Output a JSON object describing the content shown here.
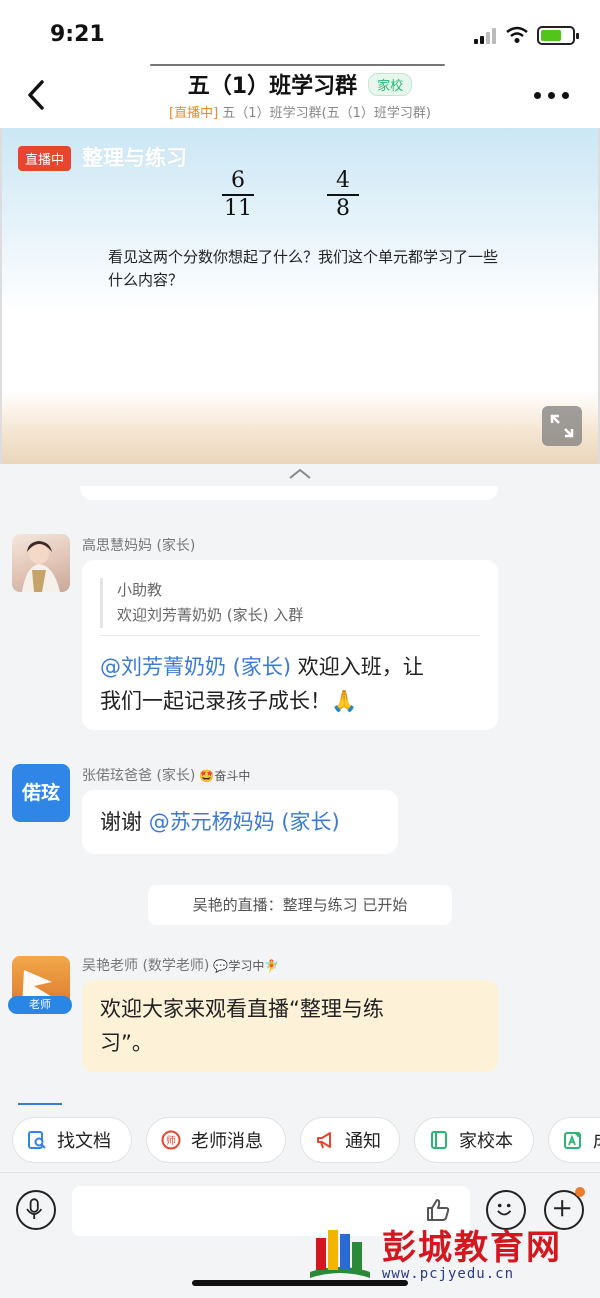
{
  "status_bar": {
    "time": "9:21"
  },
  "header": {
    "title": "五（1）班学习群",
    "tag": "家校",
    "subtitle_live": "[直播中]",
    "subtitle_text": "五（1）班学习群(五（1）班学习群)"
  },
  "live": {
    "badge": "直播中",
    "title": "整理与练习",
    "fraction1": {
      "num": "6",
      "den": "11"
    },
    "fraction2": {
      "num": "4",
      "den": "8"
    },
    "question": "看见这两个分数你想起了什么？我们这个单元都学习了一些什么内容？"
  },
  "messages": [
    {
      "sender": "高思慧妈妈 (家长)",
      "quote_author": "小助教",
      "quote_text": "欢迎刘芳菁奶奶 (家长) 入群",
      "mention": "@刘芳菁奶奶 (家长)",
      "text_line1_rest": " 欢迎入班，让",
      "text_line2": "我们一起记录孩子成长！🙏"
    },
    {
      "sender": "张偌玹爸爸 (家长)",
      "status": "🤩奋斗中",
      "avatar_text": "偌玹",
      "text": "谢谢 ",
      "mention": "@苏元杨妈妈 (家长)"
    },
    {
      "system": "吴艳的直播：整理与练习 已开始"
    },
    {
      "sender": "吴艳老师 (数学老师)",
      "status": "💬学习中🧚",
      "badge": "老师",
      "text_line1": "欢迎大家来观看直播“整理与练",
      "text_line2": "习”。"
    }
  ],
  "quick_actions": [
    "找文档",
    "老师消息",
    "通知",
    "家校本",
    "成"
  ],
  "watermark": {
    "name": "彭城教育网",
    "url": "www.pcjyedu.cn"
  },
  "colors": {
    "accent_blue": "#3a7ad6",
    "live_red": "#e8452f",
    "teacher_bubble": "#fdf1d7",
    "school_green": "#2bb673"
  }
}
